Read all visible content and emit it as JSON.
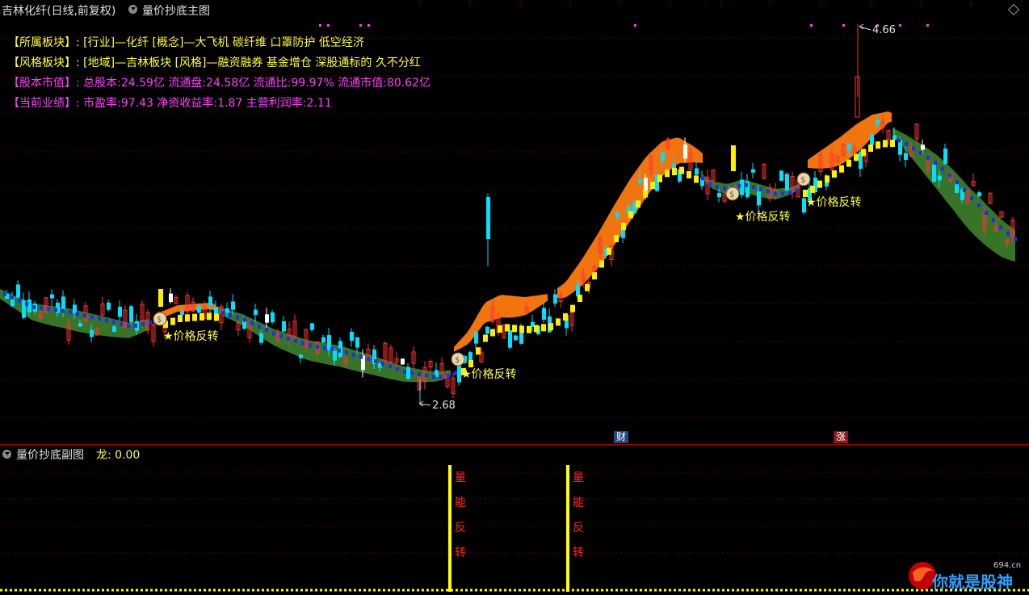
{
  "header": {
    "stock_title": "吉林化纤(日线,前复权)",
    "indicator_title": "量价抄底主图"
  },
  "info": {
    "sector_key": "【所属板块】:",
    "sector_val": "[行业]—化纤 [概念]—大飞机 碳纤维 口罩防护 低空经济",
    "style_key": "【风格板块】:",
    "style_val": "[地域]—吉林板块 [风格]—融资融券 基金增仓 深股通标的 久不分红",
    "cap_key": "【股本市值】:",
    "cap_val": "总股本:24.59亿 流通盘:24.58亿 流通比:99.97% 流通市值:80.62亿",
    "perf_key": "【当前业绩】:",
    "perf_val": "市盈率:97.43 净资收益率:1.87 主营利润率:2.11"
  },
  "signals": {
    "reversal_label": "★价格反转"
  },
  "price_labels": {
    "high": "4.66",
    "low": "2.68"
  },
  "badges": {
    "cai": "财",
    "zhang": "涨"
  },
  "sub_panel": {
    "title": "量价抄底副图",
    "value_label": "龙: 0.00",
    "signal_chars": [
      "量",
      "能",
      "反",
      "转"
    ]
  },
  "logo": {
    "site": "694.cn",
    "slogan": "你就是股神"
  },
  "colors": {
    "up": "#ff3232",
    "down": "#00e0ff",
    "white_candle": "#ffffff",
    "band_green": "#3a7a2a",
    "band_orange": "#ff7a10",
    "band_orange_dark": "#d86a10",
    "ma_blue": "#1c2cff",
    "ma_yellow": "#ffee00",
    "signal_yellow": "#ffff3c",
    "info_magenta": "#ff40ff"
  },
  "chart_data": {
    "type": "candlestick",
    "title": "吉林化纤(日线,前复权)",
    "price_range_visible": [
      2.68,
      4.66
    ],
    "annotations": [
      {
        "text": "4.66",
        "kind": "high"
      },
      {
        "text": "2.68",
        "kind": "low"
      },
      {
        "text": "★价格反转",
        "kind": "signal",
        "count": 4
      }
    ],
    "sub_chart": {
      "title": "量价抄底副图",
      "series": [
        {
          "name": "龙",
          "last_value": 0.0
        }
      ],
      "signals": 2
    }
  }
}
